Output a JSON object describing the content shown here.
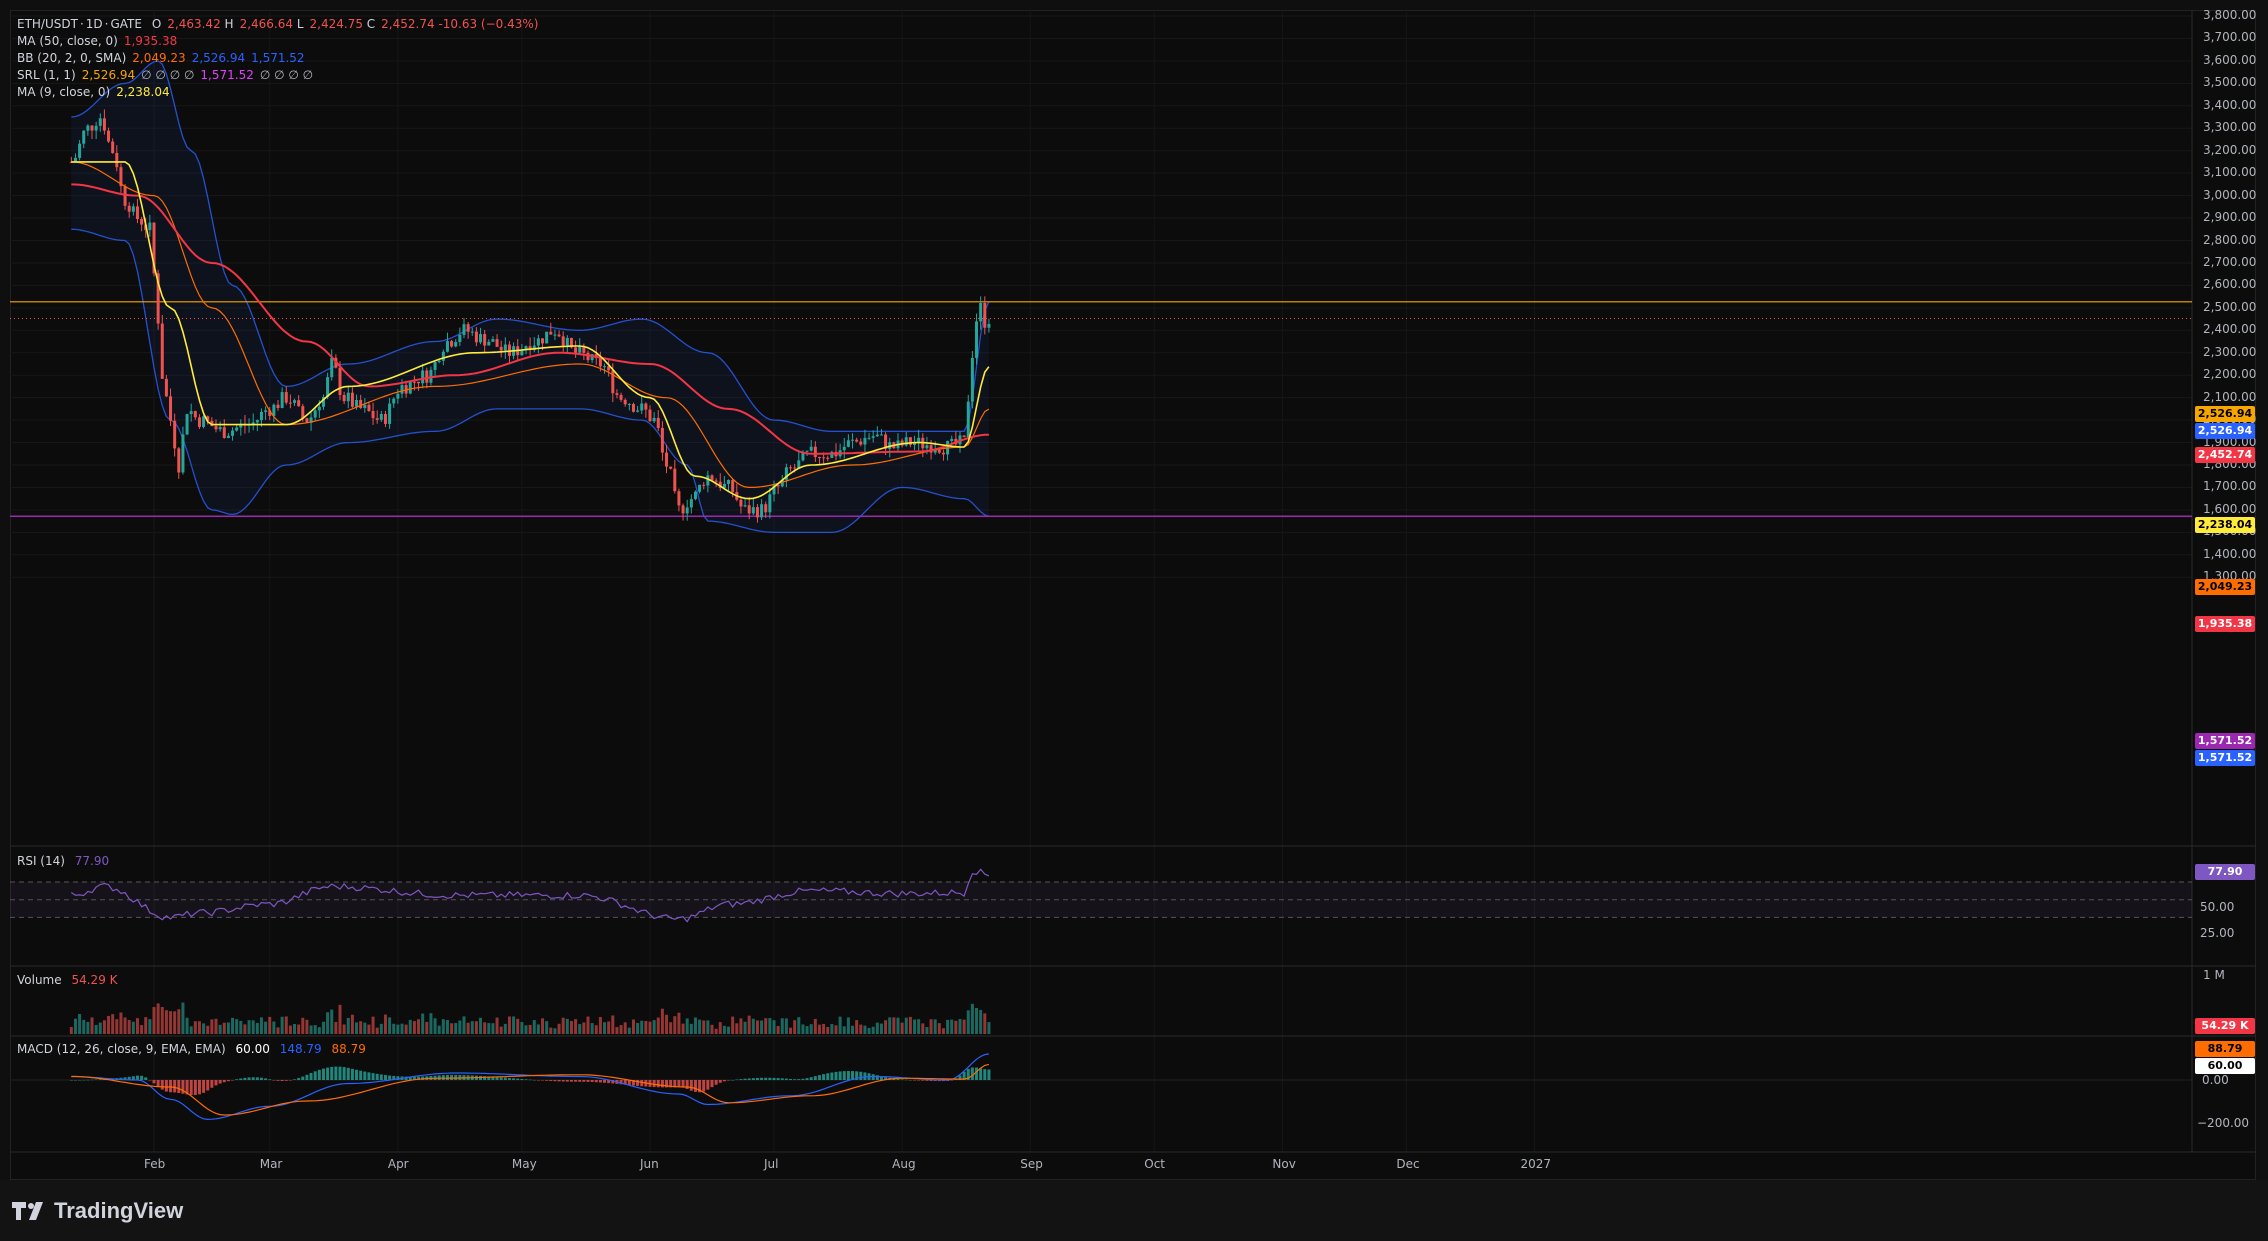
{
  "header": {
    "symbol": "ETH/USDT",
    "sep1": "·",
    "interval": "1D",
    "sep2": "·",
    "exchange": "GATE",
    "o_label": "O",
    "o": "2,463.42",
    "h_label": "H",
    "h": "2,466.64",
    "l_label": "L",
    "l": "2,424.75",
    "c_label": "C",
    "c": "2,452.74",
    "change": "-10.63 (−0.43%)"
  },
  "indicators": {
    "ma50": {
      "label": "MA (50, close, 0)",
      "value": "1,935.38"
    },
    "bb": {
      "label": "BB (20, 2, 0, SMA)",
      "basis": "2,049.23",
      "upper": "2,526.94",
      "lower": "1,571.52"
    },
    "srl": {
      "label": "SRL (1, 1)",
      "v1": "2,526.94",
      "z1": "∅ ∅ ∅ ∅",
      "v2": "1,571.52",
      "z2": "∅ ∅ ∅ ∅"
    },
    "ma9": {
      "label": "MA (9, close, 0)",
      "value": "2,238.04"
    }
  },
  "rsi": {
    "label": "RSI (14)",
    "value": "77.90",
    "ticks": [
      "50.00",
      "25.00"
    ]
  },
  "volume": {
    "label": "Volume",
    "value": "54.29 K",
    "tick": "1 M",
    "tag": "54.29 K"
  },
  "macd": {
    "label": "MACD (12, 26, close, 9, EMA, EMA)",
    "hist": "60.00",
    "macd": "148.79",
    "signal": "88.79",
    "ticks": [
      "0.00",
      "−200.00"
    ]
  },
  "price_axis_ticks": [
    "3,800.00",
    "3,700.00",
    "3,600.00",
    "3,500.00",
    "3,400.00",
    "3,300.00",
    "3,200.00",
    "3,100.00",
    "3,000.00",
    "2,900.00",
    "2,800.00",
    "2,700.00",
    "2,600.00",
    "2,500.00",
    "2,400.00",
    "2,300.00",
    "2,200.00",
    "2,100.00",
    "2,000.00",
    "1,900.00",
    "1,800.00",
    "1,700.00",
    "1,600.00",
    "1,500.00",
    "1,400.00",
    "1,300.00"
  ],
  "price_tags": {
    "srl_up": "2,526.94",
    "bb_up": "2,526.94",
    "last": "2,452.74",
    "ma9": "2,238.04",
    "bb_basis": "2,049.23",
    "ma50": "1,935.38",
    "srl_low": "1,571.52",
    "bb_low": "1,571.52"
  },
  "time_axis": [
    "Feb",
    "Mar",
    "Apr",
    "May",
    "Jun",
    "Jul",
    "Aug",
    "Sep",
    "Oct",
    "Nov",
    "Dec",
    "2027"
  ],
  "brand": "TradingView",
  "colors": {
    "up": "#26a69a",
    "down": "#ef5350",
    "ma50": "#f23645",
    "ma9": "#ffeb3b",
    "bb_band": "#2962ff",
    "bb_basis": "#ff6d00",
    "srl": "#f7a600",
    "rsi": "#7e57c2"
  },
  "chart_data": {
    "type": "candlestick",
    "symbol": "ETH/USDT",
    "interval": "1D",
    "ylim": [
      1250,
      3800
    ],
    "x_months": [
      "Feb",
      "Mar",
      "Apr",
      "May",
      "Jun",
      "Jul",
      "Aug",
      "Sep",
      "Oct",
      "Nov",
      "Dec",
      "2027"
    ],
    "close_anchors": [
      [
        "Jan 12",
        3150
      ],
      [
        "Jan 16",
        3300
      ],
      [
        "Jan 19",
        3350
      ],
      [
        "Jan 22",
        3200
      ],
      [
        "Jan 25",
        2980
      ],
      [
        "Jan 28",
        2900
      ],
      [
        "Jan 31",
        2850
      ],
      [
        "Feb 2",
        2450
      ],
      [
        "Feb 3",
        2200
      ],
      [
        "Feb 5",
        2000
      ],
      [
        "Feb 7",
        1800
      ],
      [
        "Feb 9",
        2050
      ],
      [
        "Feb 12",
        2000
      ],
      [
        "Feb 18",
        1950
      ],
      [
        "Feb 24",
        1980
      ],
      [
        "Mar 1",
        2050
      ],
      [
        "Mar 5",
        2100
      ],
      [
        "Mar 10",
        2000
      ],
      [
        "Mar 14",
        2100
      ],
      [
        "Mar 16",
        2250
      ],
      [
        "Mar 19",
        2100
      ],
      [
        "Mar 23",
        2050
      ],
      [
        "Mar 28",
        2000
      ],
      [
        "Apr 2",
        2150
      ],
      [
        "Apr 8",
        2200
      ],
      [
        "Apr 13",
        2350
      ],
      [
        "Apr 17",
        2400
      ],
      [
        "Apr 22",
        2360
      ],
      [
        "Apr 28",
        2300
      ],
      [
        "May 4",
        2350
      ],
      [
        "May 9",
        2400
      ],
      [
        "May 14",
        2300
      ],
      [
        "May 20",
        2250
      ],
      [
        "May 25",
        2100
      ],
      [
        "May 30",
        2050
      ],
      [
        "Jun 2",
        2000
      ],
      [
        "Jun 5",
        1800
      ],
      [
        "Jun 8",
        1600
      ],
      [
        "Jun 11",
        1650
      ],
      [
        "Jun 15",
        1750
      ],
      [
        "Jun 20",
        1700
      ],
      [
        "Jun 24",
        1600
      ],
      [
        "Jun 28",
        1600
      ],
      [
        "Jul 2",
        1700
      ],
      [
        "Jul 5",
        1780
      ],
      [
        "Jul 10",
        1850
      ],
      [
        "Jul 15",
        1850
      ],
      [
        "Jul 20",
        1900
      ],
      [
        "Jul 25",
        1930
      ],
      [
        "Jul 30",
        1880
      ],
      [
        "Aug 3",
        1900
      ],
      [
        "Aug 8",
        1890
      ],
      [
        "Aug 12",
        1880
      ],
      [
        "Aug 16",
        1900
      ],
      [
        "Aug 17",
        2100
      ],
      [
        "Aug 18",
        2300
      ],
      [
        "Aug 19",
        2450
      ],
      [
        "Aug 20",
        2500
      ],
      [
        "Aug 21",
        2440
      ],
      [
        "Aug 22",
        2453
      ]
    ],
    "ma50_anchors": [
      [
        "Jan 12",
        3050
      ],
      [
        "Jan 28",
        3000
      ],
      [
        "Feb 15",
        2700
      ],
      [
        "Mar 10",
        2350
      ],
      [
        "Mar 25",
        2150
      ],
      [
        "Apr 15",
        2200
      ],
      [
        "May 10",
        2300
      ],
      [
        "Jun 1",
        2250
      ],
      [
        "Jun 20",
        2050
      ],
      [
        "Jul 10",
        1850
      ],
      [
        "Aug 5",
        1860
      ],
      [
        "Aug 22",
        1935
      ]
    ],
    "ma9_anchors": [
      [
        "Jan 12",
        3150
      ],
      [
        "Jan 25",
        3150
      ],
      [
        "Feb 5",
        2500
      ],
      [
        "Feb 15",
        1980
      ],
      [
        "Mar 5",
        1980
      ],
      [
        "Mar 20",
        2150
      ],
      [
        "Apr 20",
        2300
      ],
      [
        "May 15",
        2330
      ],
      [
        "Jun 1",
        2100
      ],
      [
        "Jun 12",
        1750
      ],
      [
        "Jun 25",
        1650
      ],
      [
        "Jul 10",
        1800
      ],
      [
        "Aug 5",
        1900
      ],
      [
        "Aug 16",
        1880
      ],
      [
        "Aug 22",
        2238
      ]
    ],
    "bb_upper_anchors": [
      [
        "Jan 12",
        3350
      ],
      [
        "Jan 25",
        3500
      ],
      [
        "Feb 2",
        3600
      ],
      [
        "Feb 10",
        3200
      ],
      [
        "Feb 20",
        2600
      ],
      [
        "Mar 5",
        2150
      ],
      [
        "Mar 20",
        2250
      ],
      [
        "Apr 10",
        2350
      ],
      [
        "Apr 25",
        2450
      ],
      [
        "May 15",
        2400
      ],
      [
        "May 30",
        2450
      ],
      [
        "Jun 15",
        2300
      ],
      [
        "Jul 1",
        2000
      ],
      [
        "Jul 15",
        1950
      ],
      [
        "Aug 5",
        1950
      ],
      [
        "Aug 16",
        1950
      ],
      [
        "Aug 22",
        2527
      ]
    ],
    "bb_lower_anchors": [
      [
        "Jan 12",
        2850
      ],
      [
        "Jan 25",
        2800
      ],
      [
        "Feb 5",
        2000
      ],
      [
        "Feb 15",
        1600
      ],
      [
        "Feb 20",
        1580
      ],
      [
        "Mar 5",
        1800
      ],
      [
        "Mar 20",
        1900
      ],
      [
        "Apr 10",
        1950
      ],
      [
        "Apr 25",
        2050
      ],
      [
        "May 15",
        2050
      ],
      [
        "May 30",
        2000
      ],
      [
        "Jun 10",
        1800
      ],
      [
        "Jun 15",
        1550
      ],
      [
        "Jul 1",
        1500
      ],
      [
        "Jul 15",
        1500
      ],
      [
        "Aug 1",
        1700
      ],
      [
        "Aug 16",
        1650
      ],
      [
        "Aug 22",
        1572
      ]
    ],
    "bb_basis_anchors": [
      [
        "Jan 12",
        3150
      ],
      [
        "Feb 1",
        3000
      ],
      [
        "Feb 15",
        2500
      ],
      [
        "Mar 5",
        1980
      ],
      [
        "Apr 10",
        2150
      ],
      [
        "May 15",
        2250
      ],
      [
        "Jun 5",
        2100
      ],
      [
        "Jun 25",
        1700
      ],
      [
        "Jul 20",
        1800
      ],
      [
        "Aug 16",
        1880
      ],
      [
        "Aug 22",
        2049
      ]
    ],
    "srl_levels": [
      2526.94,
      1571.52
    ],
    "last_price": 2452.74,
    "rsi_ylim": [
      0,
      100
    ],
    "rsi_levels": [
      70,
      50,
      30
    ],
    "rsi_last": 77.9,
    "rsi_anchors": [
      [
        "Jan 12",
        55
      ],
      [
        "Jan 20",
        65
      ],
      [
        "Feb 5",
        30
      ],
      [
        "Feb 12",
        35
      ],
      [
        "Mar 1",
        45
      ],
      [
        "Mar 16",
        65
      ],
      [
        "Apr 15",
        55
      ],
      [
        "May 15",
        55
      ],
      [
        "Jun 8",
        28
      ],
      [
        "Jun 20",
        45
      ],
      [
        "Jul 10",
        60
      ],
      [
        "Aug 1",
        57
      ],
      [
        "Aug 16",
        58
      ],
      [
        "Aug 18",
        83
      ],
      [
        "Aug 22",
        78
      ]
    ],
    "volume_max_label": "1 M",
    "volume_last": "54.29 K",
    "macd_ylim": [
      -250,
      120
    ],
    "macd_hist_last": 60.0,
    "macd_line_last": 148.79,
    "macd_signal_last": 88.79,
    "macd_anchors": [
      [
        "Jan 12",
        20
      ],
      [
        "Jan 28",
        0
      ],
      [
        "Feb 5",
        -110
      ],
      [
        "Feb 14",
        -225
      ],
      [
        "Mar 1",
        -150
      ],
      [
        "Mar 20",
        -20
      ],
      [
        "Apr 15",
        40
      ],
      [
        "May 15",
        20
      ],
      [
        "Jun 8",
        -80
      ],
      [
        "Jun 15",
        -140
      ],
      [
        "Jul 5",
        -90
      ],
      [
        "Jul 25",
        20
      ],
      [
        "Aug 12",
        0
      ],
      [
        "Aug 22",
        149
      ]
    ],
    "signal_anchors": [
      [
        "Jan 12",
        20
      ],
      [
        "Feb 5",
        -40
      ],
      [
        "Feb 18",
        -200
      ],
      [
        "Mar 10",
        -120
      ],
      [
        "Apr 10",
        10
      ],
      [
        "May 15",
        30
      ],
      [
        "Jun 10",
        -40
      ],
      [
        "Jun 20",
        -130
      ],
      [
        "Jul 10",
        -90
      ],
      [
        "Aug 1",
        10
      ],
      [
        "Aug 16",
        5
      ],
      [
        "Aug 22",
        89
      ]
    ]
  }
}
